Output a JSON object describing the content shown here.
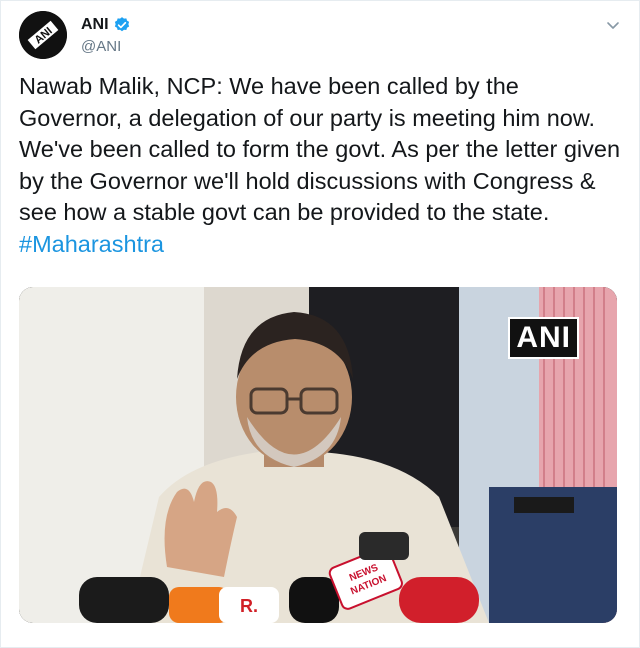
{
  "user": {
    "display_name": "ANI",
    "handle": "@ANI",
    "avatar_icon": "ani-logo-avatar",
    "verified_icon": "verified-badge-icon",
    "verified_color": "#1da1f2"
  },
  "menu": {
    "icon": "chevron-down-icon"
  },
  "tweet": {
    "text_before_hashtag": "Nawab Malik, NCP: We have been called by the Governor, a delegation of our party is meeting him now. We've been called to form the govt. As per the letter given by the Governor we'll hold discussions with Congress & see how a stable govt can be provided to the state. ",
    "hashtag": "#Maharashtra",
    "hashtag_color": "#1b95e0"
  },
  "media": {
    "watermark": "ANI",
    "microphone_labels": [
      "NEWS NATION",
      "R."
    ]
  }
}
